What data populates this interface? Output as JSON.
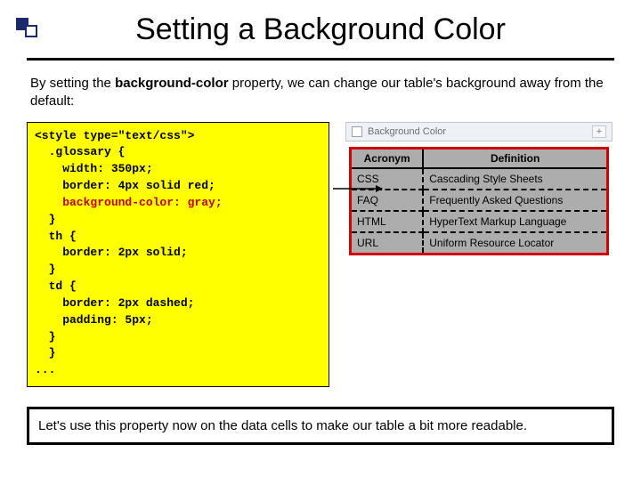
{
  "title": "Setting a Background Color",
  "intro_before": "By setting the ",
  "intro_keyword": "background-color",
  "intro_after": " property, we can change our table's background away from the default:",
  "code": {
    "l1": "<style type=\"text/css\">",
    "l2": "  .glossary {",
    "l3": "    width: 350px;",
    "l4": "    border: 4px solid red;",
    "l5": "    background-color: gray;",
    "l6": "  }",
    "l7": "  th {",
    "l8": "    border: 2px solid;",
    "l9": "  }",
    "l10": "  td {",
    "l11": "    border: 2px dashed;",
    "l12": "    padding: 5px;",
    "l13": "  }",
    "l14": "  }",
    "l15": "..."
  },
  "browser_tab": "Background Color",
  "table": {
    "head": {
      "c1": "Acronym",
      "c2": "Definition"
    },
    "rows": [
      {
        "c1": "CSS",
        "c2": "Cascading Style Sheets"
      },
      {
        "c1": "FAQ",
        "c2": "Frequently Asked Questions"
      },
      {
        "c1": "HTML",
        "c2": "HyperText Markup Language"
      },
      {
        "c1": "URL",
        "c2": "Uniform Resource Locator"
      }
    ]
  },
  "callout": "Let's use this property now on the data cells to make our table a bit more readable."
}
